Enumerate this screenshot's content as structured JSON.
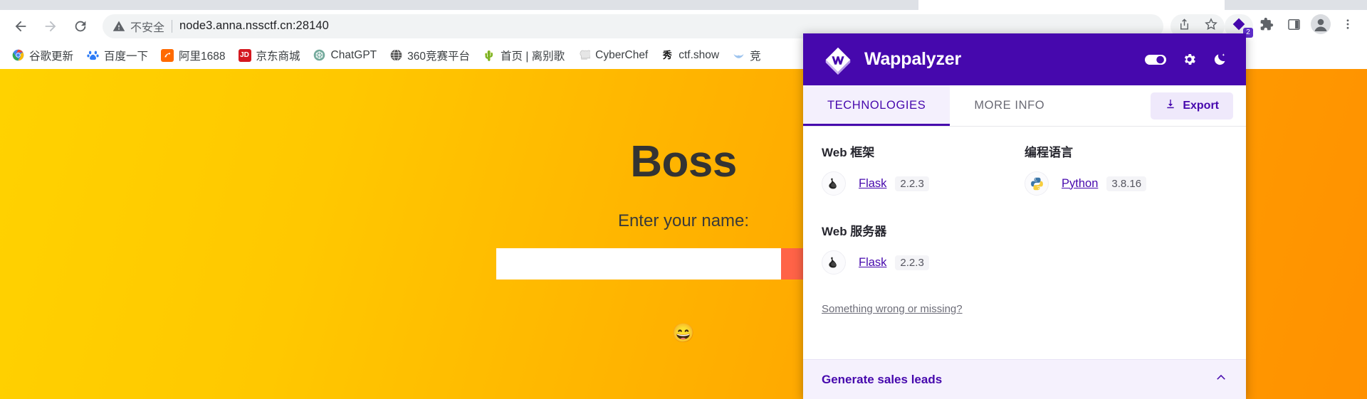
{
  "browser": {
    "nav": {
      "back_icon": "arrow-left-icon",
      "forward_icon": "arrow-right-icon",
      "reload_icon": "reload-icon"
    },
    "omnibox": {
      "security_icon": "warning-triangle-icon",
      "security_text": "不安全",
      "url": "node3.anna.nssctf.cn:28140",
      "url_host": "node3.anna.nssctf.cn",
      "url_port": ":28140"
    },
    "toolbar_icons": [
      {
        "name": "share-icon"
      },
      {
        "name": "bookmark-star-icon"
      },
      {
        "name": "wappalyzer-extension-icon",
        "badge": "2"
      },
      {
        "name": "extensions-puzzle-icon"
      },
      {
        "name": "side-panel-icon"
      },
      {
        "name": "profile-avatar-icon"
      },
      {
        "name": "chrome-menu-icon"
      }
    ],
    "bookmarks": [
      {
        "label": "谷歌更新",
        "icon": "chrome-icon"
      },
      {
        "label": "百度一下",
        "icon": "baidu-icon"
      },
      {
        "label": "阿里1688",
        "icon": "alibaba-icon"
      },
      {
        "label": "京东商城",
        "icon": "jd-icon"
      },
      {
        "label": "ChatGPT",
        "icon": "openai-icon"
      },
      {
        "label": "360竞赛平台",
        "icon": "globe-icon"
      },
      {
        "label": "首页 | 离别歌",
        "icon": "cactus-icon"
      },
      {
        "label": "CyberChef",
        "icon": "chef-hat-icon"
      },
      {
        "label": "ctf.show",
        "icon": "ctfshow-icon"
      },
      {
        "label": "竞",
        "icon": "bird-icon"
      }
    ]
  },
  "page": {
    "title": "Boss",
    "label": "Enter your name:",
    "input_value": "",
    "input_placeholder": "",
    "submit_label": "",
    "emoji": "😄",
    "bg_start": "#FFD200",
    "bg_end": "#FF9100",
    "submit_color": "#FF6347"
  },
  "wappalyzer": {
    "brand": "Wappalyzer",
    "brand_color": "#4608AD",
    "header_icons": [
      {
        "name": "toggle-switch-icon"
      },
      {
        "name": "gear-icon"
      },
      {
        "name": "dark-mode-moon-icon"
      }
    ],
    "tabs": [
      {
        "label": "TECHNOLOGIES",
        "active": true
      },
      {
        "label": "MORE INFO",
        "active": false
      }
    ],
    "export_label": "Export",
    "export_icon": "download-icon",
    "categories_left": [
      {
        "title": "Web 框架",
        "items": [
          {
            "name": "Flask",
            "version": "2.2.3",
            "icon": "flask-icon"
          }
        ]
      },
      {
        "title": "Web 服务器",
        "items": [
          {
            "name": "Flask",
            "version": "2.2.3",
            "icon": "flask-icon"
          }
        ]
      }
    ],
    "categories_right": [
      {
        "title": "编程语言",
        "items": [
          {
            "name": "Python",
            "version": "3.8.16",
            "icon": "python-icon"
          }
        ]
      }
    ],
    "wrong_link": "Something wrong or missing?",
    "footer_title": "Generate sales leads",
    "footer_chevron": "chevron-up-icon"
  }
}
